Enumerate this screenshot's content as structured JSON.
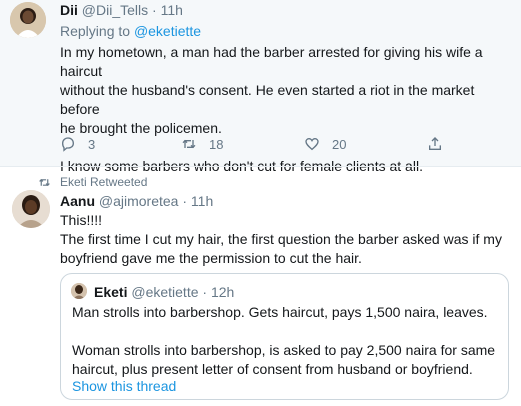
{
  "tweet1": {
    "author_name": "Dii",
    "author_handle": "@Dii_Tells",
    "time": "11h",
    "replying_prefix": "Replying to",
    "replying_to": "@eketiette",
    "text_lines": [
      "In my hometown, a man had the barber arrested for giving his wife a haircut",
      "without the husband's consent. He even started a riot in the market before",
      "he brought the policemen.",
      "I know some barbers who don't cut for female clients at all."
    ],
    "reply_count": "3",
    "retweet_count": "18",
    "like_count": "20"
  },
  "retweet_notice": "Eketi Retweeted",
  "tweet2": {
    "author_name": "Aanu",
    "author_handle": "@ajimoretea",
    "time": "11h",
    "text_lines": [
      "This!!!!",
      "The first time I cut my hair, the first question the barber asked was if my",
      "boyfriend gave me the permission to cut the hair."
    ]
  },
  "quoted": {
    "author_name": "Eketi",
    "author_handle": "@eketiette",
    "time": "12h",
    "text_lines": [
      "Man strolls into barbershop. Gets haircut, pays 1,500 naira, leaves.",
      "Woman strolls into barbershop, is asked to pay 2,500 naira for same",
      "haircut, plus present letter of consent from husband or boyfriend."
    ],
    "show_thread": "Show this thread"
  },
  "colors": {
    "link": "#1b95e0",
    "secondary_text": "#657786",
    "primary_text": "#14171a",
    "highlight_bg": "#f5f8fa",
    "border": "#ccd6dd"
  },
  "icons": [
    "reply-icon",
    "retweet-icon",
    "like-icon",
    "share-icon",
    "retweeted-icon"
  ]
}
